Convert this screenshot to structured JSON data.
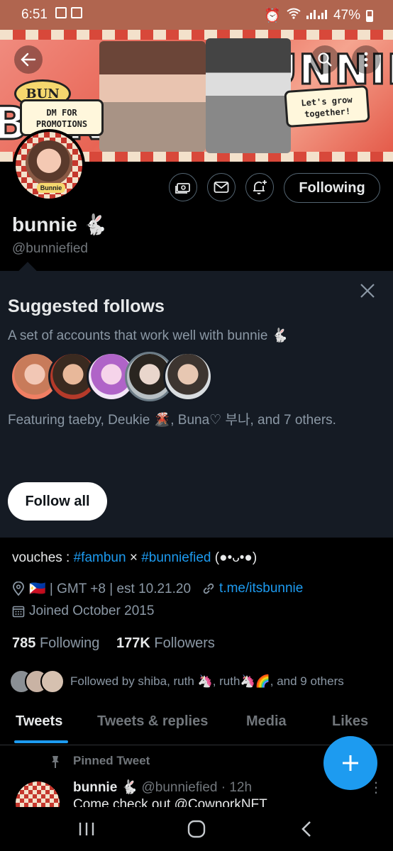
{
  "status_bar": {
    "time": "6:51",
    "battery": "47%"
  },
  "banner": {
    "left_word": "BUN",
    "right_word": "UNNIE",
    "badge": "BUN",
    "promo_note": "DM FOR PROMOTIONS",
    "grow_note": "Let's grow together!"
  },
  "avatar_tag": "Bunnie",
  "actions": {
    "following_label": "Following"
  },
  "profile": {
    "name": "bunnie 🐇",
    "handle": "@bunniefied",
    "bio_prefix": "vouches : ",
    "bio_tag1": "#fambun",
    "bio_sep": " × ",
    "bio_tag2": "#bunniefied",
    "bio_suffix": " (●•ᴗ•●)",
    "location": "🇵🇭 | GMT +8 | est 10.21.20",
    "website": "t.me/itsbunnie",
    "joined": "Joined October 2015",
    "following_count": "785",
    "following_label": "Following",
    "followers_count": "177K",
    "followers_label": "Followers",
    "followed_by": "Followed by shiba, ruth 🦄, ruth🦄🌈, and 9 others"
  },
  "suggested": {
    "title": "Suggested follows",
    "subtitle": "A set of accounts that work well with bunnie 🐇",
    "featuring": "Featuring taeby, Deukie 🌋, Buna♡ 부나, and 7 others.",
    "follow_all": "Follow all"
  },
  "tabs": [
    "Tweets",
    "Tweets & replies",
    "Media",
    "Likes"
  ],
  "tweet": {
    "pinned_label": "Pinned Tweet",
    "author": "bunnie 🐇",
    "meta": " @bunniefied · 12h",
    "text": "Come check out @CownorkNFT"
  },
  "colors": {
    "accent": "#1d9bf0",
    "background": "#000000",
    "card": "#151b24",
    "status_bar": "#b0654f"
  }
}
